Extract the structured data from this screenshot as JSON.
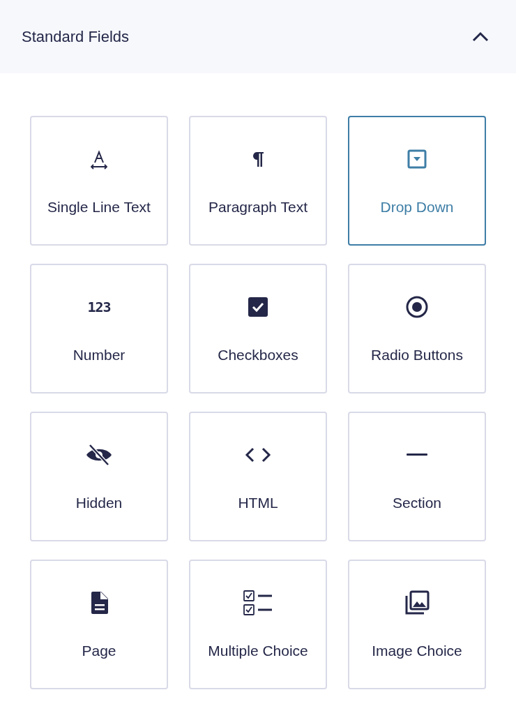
{
  "panel": {
    "title": "Standard Fields",
    "expanded": true
  },
  "fields": [
    {
      "label": "Single Line Text",
      "selected": false
    },
    {
      "label": "Paragraph Text",
      "selected": false
    },
    {
      "label": "Drop Down",
      "selected": true
    },
    {
      "label": "Number",
      "selected": false,
      "icon_text": "123"
    },
    {
      "label": "Checkboxes",
      "selected": false
    },
    {
      "label": "Radio Buttons",
      "selected": false
    },
    {
      "label": "Hidden",
      "selected": false
    },
    {
      "label": "HTML",
      "selected": false
    },
    {
      "label": "Section",
      "selected": false
    },
    {
      "label": "Page",
      "selected": false
    },
    {
      "label": "Multiple Choice",
      "selected": false
    },
    {
      "label": "Image Choice",
      "selected": false
    }
  ]
}
